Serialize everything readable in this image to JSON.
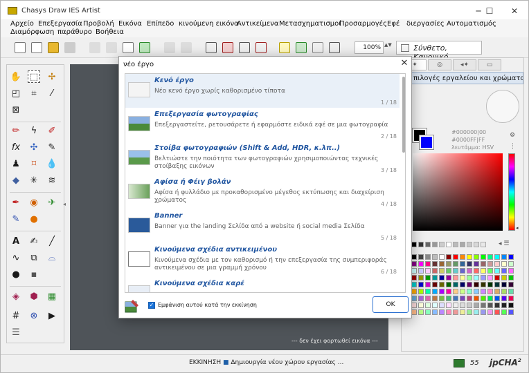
{
  "window": {
    "title": "Chasys Draw IES Artist",
    "controls": [
      "─",
      "☐",
      "✕"
    ]
  },
  "menu": {
    "items": [
      "Αρχείο",
      "Επεξεργασία",
      "Προβολή",
      "Εικόνα",
      "Επίπεδο",
      "κινούμενη εικόνα",
      "Αντικείμενα",
      "Μετασχηματισμοί",
      "Προσαρμογές",
      "Εφέ",
      "διεργασίες",
      "Αυτοματισμός",
      "Διαμόρφωση",
      "παράθυρο",
      "Βοήθεια"
    ]
  },
  "toolbar": {
    "zoom": "100%",
    "zoom_arrows": "▲▼",
    "mode": "Σύνθετο, Κανονικό"
  },
  "tools_panel": {
    "edge_arrow": "◂",
    "glyphs": [
      "✋",
      "⬚",
      "✢",
      "◰",
      "⌗",
      "⁄",
      "⊠",
      "✏",
      "ϟ",
      "✐",
      "fx",
      "✣",
      "✎",
      "♟",
      "⌑",
      "💧",
      "◆",
      "✳",
      "≋",
      "✒",
      "◉",
      "✈",
      "✎",
      "●",
      "A",
      "✍",
      "╱",
      "∿",
      "⧉",
      "⌓",
      "●",
      "▪",
      "◈",
      "⬢",
      "▦",
      "#",
      "⊗",
      "▶",
      "☰"
    ]
  },
  "canvas": {
    "status": "--- δεν έχει φορτωθεί εικόνα ---"
  },
  "right_panel": {
    "tabs": [
      "✦",
      "◎",
      "◂✦",
      "▭"
    ],
    "title": "πιλογές εργαλείου και χρώματα",
    "hex_lines": [
      "#000000|00",
      "#0000FF|FF",
      "λευτάμμα: HSV"
    ],
    "picker_icons": [
      "⚙",
      "⋮"
    ],
    "grays_icons": "◂  ☰",
    "hue_arrow": "◂",
    "colors": {
      "foreground": "#000000",
      "background": "#0000ff"
    }
  },
  "dialog": {
    "title": "νέο έργο",
    "close": "✕",
    "items": [
      {
        "title": "Κενό έργο",
        "desc": "Νέο κενό έργο χωρίς καθορισμένο τίποτα",
        "count": "1 / 18",
        "selected": true
      },
      {
        "title": "Επεξεργασία φωτογραφίας",
        "desc": "Επεξεργαστείτε, ρετουσάρετε ή εφαρμόστε ειδικά εφέ σε μια φωτογραφία",
        "count": "2 / 18"
      },
      {
        "title": "Στοίβα φωτογραφιών (Shift & Add, HDR, κ.λπ..)",
        "desc": "Βελτιώστε την ποιότητα των φωτογραφιών χρησιμοποιώντας τεχνικές στοίβαξης εικόνων",
        "count": "3 / 18"
      },
      {
        "title": "Αφίσα ή Φέιγ βολάν",
        "desc": "Αφίσα ή φυλλάδιο με προκαθορισμένο μέγεθος εκτύπωσης και διαχείριση χρώματος",
        "count": "4 / 18"
      },
      {
        "title": "Banner",
        "desc": "Banner για the landing Σελίδα από a website ή social media Σελίδα",
        "count": "5 / 18"
      },
      {
        "title": "Κινούμενα σχέδια αντικειμένου",
        "desc": "Κινούμενα σχέδια με τον καθορισμό ή την επεξεργασία της συμπεριφοράς αντικειμένου σε μια γραμμή χρόνου",
        "count": "6 / 18"
      },
      {
        "title": "Κινούμενα σχέδια καρέ",
        "desc": "",
        "count": ""
      }
    ],
    "checkbox_label": "Εμφάνιση αυτού κατά την εκκίνηση",
    "checkbox_checked": true,
    "ok": "OK"
  },
  "statusbar": {
    "label": "ΕΚΚΙΝΗΣΗ",
    "separator": "■",
    "message": "Δημιουργία νέου χώρου εργασίας ...",
    "memory": "55",
    "brand": "jpCHA",
    "brand_sup": "2"
  }
}
